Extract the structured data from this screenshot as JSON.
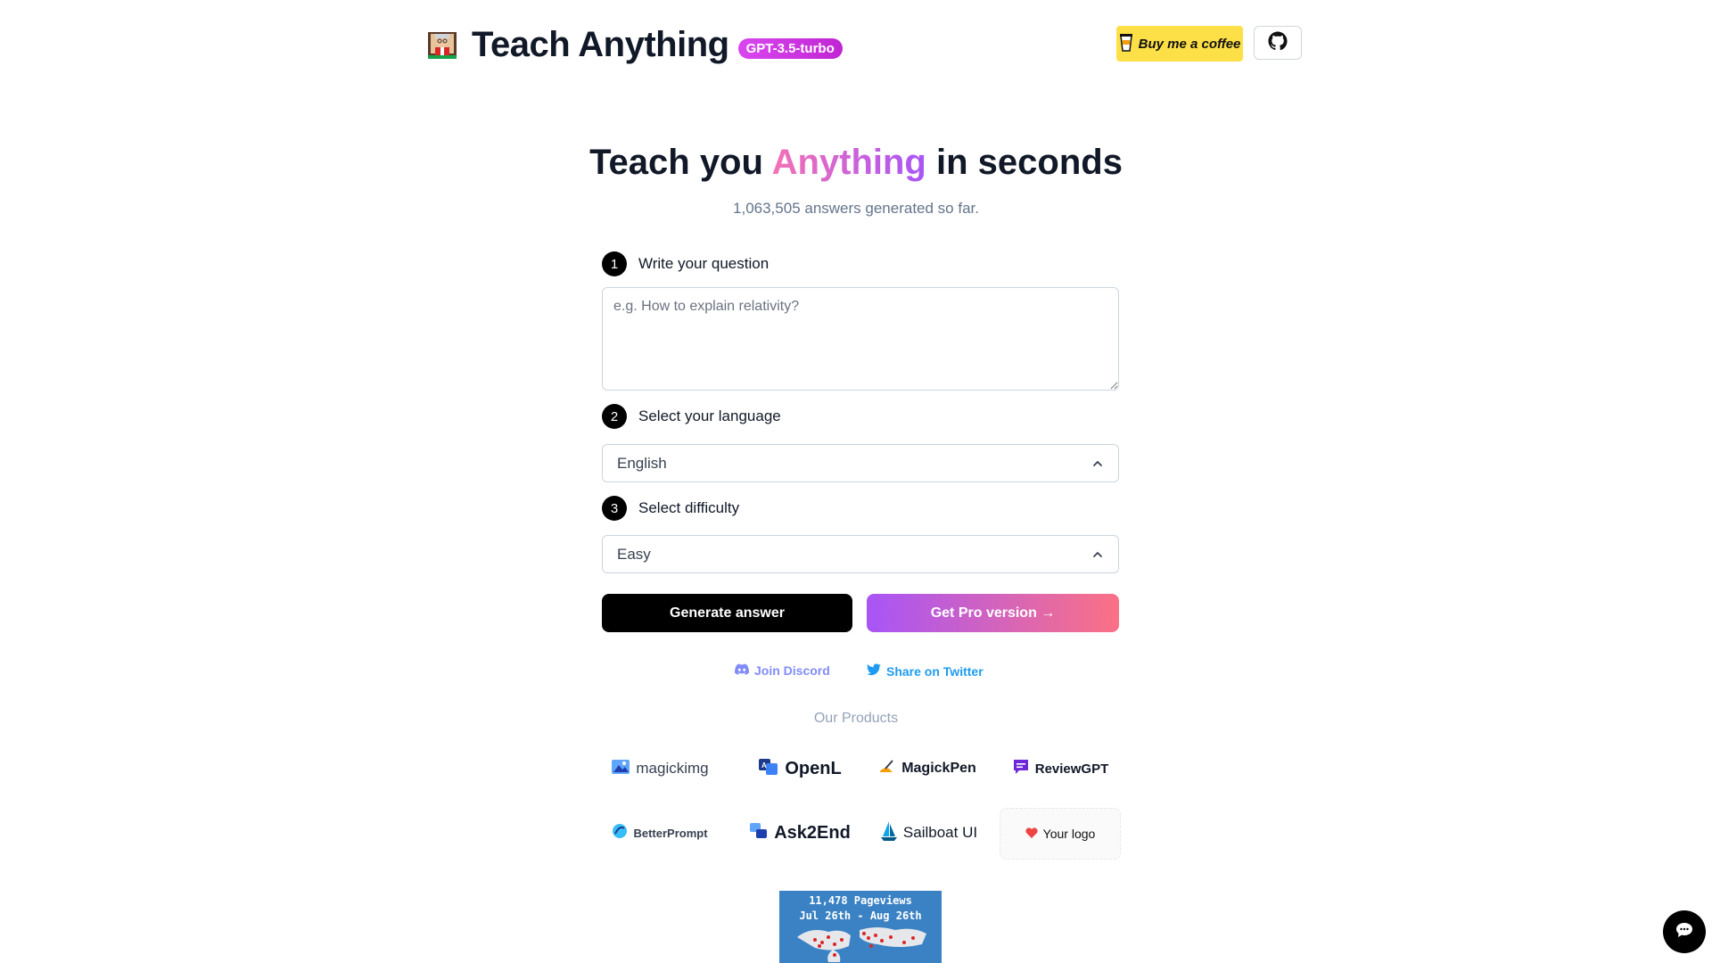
{
  "header": {
    "title": "Teach Anything",
    "badge": "GPT-3.5-turbo",
    "coffee_label": "Buy me a coffee"
  },
  "hero": {
    "title_before": "Teach you ",
    "title_accent": "Anything",
    "title_after": " in seconds",
    "counter": "1,063,505 answers generated so far."
  },
  "steps": [
    {
      "num": "1",
      "label": "Write your question"
    },
    {
      "num": "2",
      "label": "Select your language"
    },
    {
      "num": "3",
      "label": "Select difficulty"
    }
  ],
  "question": {
    "placeholder": "e.g. How to explain relativity?",
    "value": ""
  },
  "language": {
    "selected": "English"
  },
  "difficulty": {
    "selected": "Easy"
  },
  "buttons": {
    "generate": "Generate answer",
    "pro": "Get Pro version →"
  },
  "social": {
    "discord": "Join Discord",
    "twitter": "Share on Twitter"
  },
  "products": {
    "title": "Our Products",
    "items": [
      "magickimg",
      "OpenL",
      "MagickPen",
      "ReviewGPT",
      "BetterPrompt",
      "Ask2End",
      "Sailboat UI"
    ],
    "your_logo": "Your logo"
  },
  "stats": {
    "pageviews": "11,478 Pageviews",
    "range": "Jul 26th - Aug 26th"
  },
  "colors": {
    "accent_gradient_start": "#f472b6",
    "accent_gradient_end": "#a855f7",
    "badge": "#d946ef",
    "coffee": "#fde047",
    "discord": "#818cf8",
    "twitter": "#1d9bf0"
  }
}
